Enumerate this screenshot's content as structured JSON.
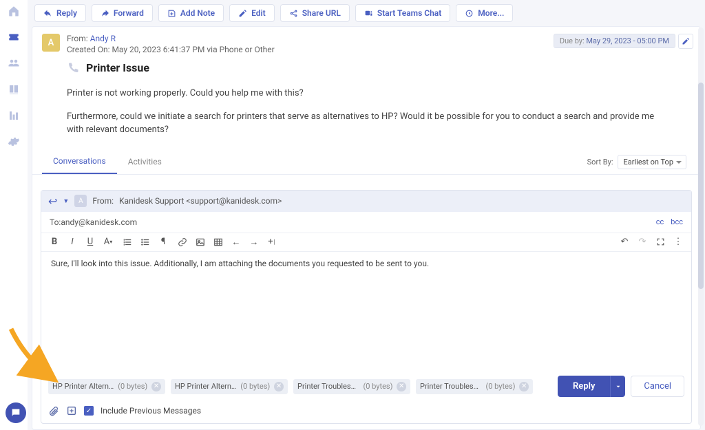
{
  "sidenav": {
    "items": [
      "home",
      "ticket",
      "contacts",
      "knowledge",
      "reports",
      "settings"
    ]
  },
  "toolbar": {
    "reply": "Reply",
    "forward": "Forward",
    "add_note": "Add Note",
    "edit": "Edit",
    "share_url": "Share URL",
    "teams": "Start Teams Chat",
    "more": "More..."
  },
  "ticket": {
    "avatar_initial": "A",
    "from_prefix": "From: ",
    "from_name": "Andy R",
    "created": "Created On: May 20, 2023 6:41:37 PM via Phone or Other",
    "subject": "Printer Issue",
    "due_prefix": "Due by: ",
    "due_value": "May 29, 2023 - 05:00 PM",
    "body_p1": "Printer is not working properly. Could you help me with this?",
    "body_p2": "Furthermore, could we initiate a search for printers that serve as alternatives to HP? Would it be possible for you to conduct a search and provide me with relevant documents?"
  },
  "tabs": {
    "conversations": "Conversations",
    "activities": "Activities"
  },
  "sort": {
    "label": "Sort By:",
    "value": "Earliest on Top"
  },
  "compose": {
    "from_label": "From: ",
    "from_value": "Kanidesk Support <support@kanidesk.com>",
    "to_label": "To: ",
    "to_value": "andy@kanidesk.com",
    "cc": "cc",
    "bcc": "bcc",
    "body": "Sure, I'll look into this issue. Additionally, I am attaching the documents you requested to be sent to you."
  },
  "attachments": [
    {
      "name": "HP Printer Altern...",
      "size": "(0 bytes)"
    },
    {
      "name": "HP Printer Altern...",
      "size": "(0 bytes)"
    },
    {
      "name": "Printer Troublesh...",
      "size": "(0 bytes)"
    },
    {
      "name": "Printer Troublesh...",
      "size": "(0 bytes)"
    }
  ],
  "footer": {
    "include_prev": "Include Previous Messages",
    "reply": "Reply",
    "cancel": "Cancel"
  }
}
